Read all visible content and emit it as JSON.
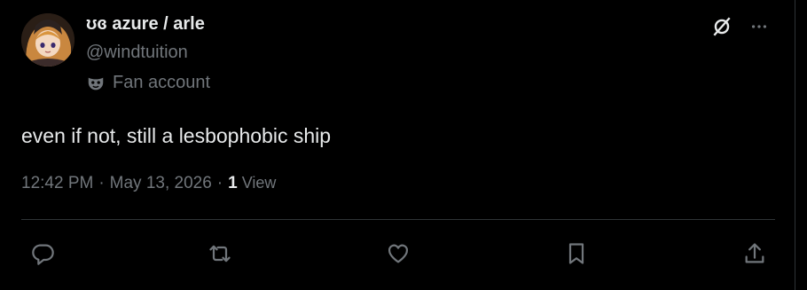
{
  "user": {
    "display_name": "ʊɞ azure / arle",
    "handle": "@windtuition",
    "label_text": "Fan account",
    "label_icon": "mask-icon",
    "avatar": "anime-character-avatar"
  },
  "header_icons": [
    "grok-icon",
    "more-icon"
  ],
  "tweet": {
    "text": "even if not, still a lesbophobic ship",
    "time": "12:42 PM",
    "separator": "·",
    "date": "May 13, 2026",
    "views_count": "1",
    "views_label": "View"
  },
  "actions": [
    "reply-icon",
    "retweet-icon",
    "like-icon",
    "bookmark-icon",
    "share-icon"
  ],
  "colors": {
    "background": "#000000",
    "text": "#e7e9ea",
    "muted": "#71767b",
    "border": "#2f3336"
  }
}
